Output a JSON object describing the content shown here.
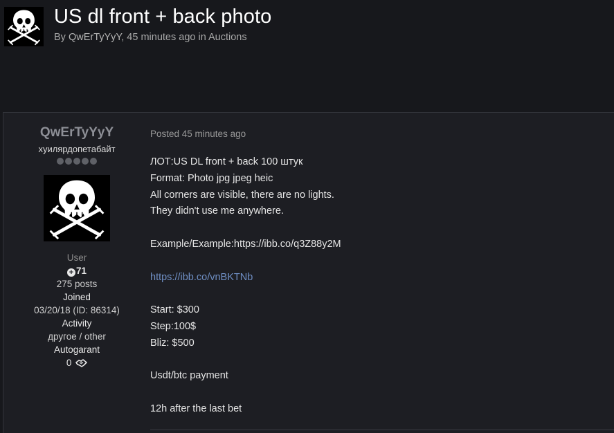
{
  "topic": {
    "title": "US dl front + back photo",
    "meta": {
      "by": "By ",
      "author": "QwErTyYyY",
      "sep": ", ",
      "time": "45 minutes ago",
      "in": " in ",
      "forum": "Auctions"
    }
  },
  "author": {
    "name": "QwErTyYyY",
    "group": "хуилярдопетабайт",
    "rank_pips": 5,
    "title": "User",
    "reputation": "71",
    "posts": "275 posts",
    "joined_label": "Joined",
    "joined_value": "03/20/18 (ID: 86314)",
    "activity_label": "Activity",
    "activity_value": "другое / other",
    "autogarant_label": "Autogarant",
    "autogarant_value": "0"
  },
  "post": {
    "posted": "Posted 45 minutes ago",
    "lines": [
      {
        "text": "ЛОТ:US DL front + back 100 штук"
      },
      {
        "text": "Format: Photo jpg jpeg heic"
      },
      {
        "text": "All corners are visible, there are no lights."
      },
      {
        "text": "They didn't use me anywhere."
      },
      {
        "text": ""
      },
      {
        "text": "Example/Example:https://ibb.co/q3Z88y2M"
      },
      {
        "text": ""
      },
      {
        "text": "https://ibb.co/vnBKTNb",
        "link": true
      },
      {
        "text": ""
      },
      {
        "text": "Start: $300"
      },
      {
        "text": "Step:100$"
      },
      {
        "text": "Bliz: $500"
      },
      {
        "text": ""
      },
      {
        "text": "Usdt/btc payment"
      },
      {
        "text": ""
      },
      {
        "text": "12h after the last bet"
      }
    ]
  },
  "icons": {
    "avatar": "skull-crossed-crutches-icon",
    "reputation": "plus-circle-icon",
    "autogarant": "handshake-icon"
  },
  "colors": {
    "background": "#17181c",
    "post_background": "#1d1e23",
    "link": "#6f8fc4",
    "username": "#8d8f96"
  }
}
